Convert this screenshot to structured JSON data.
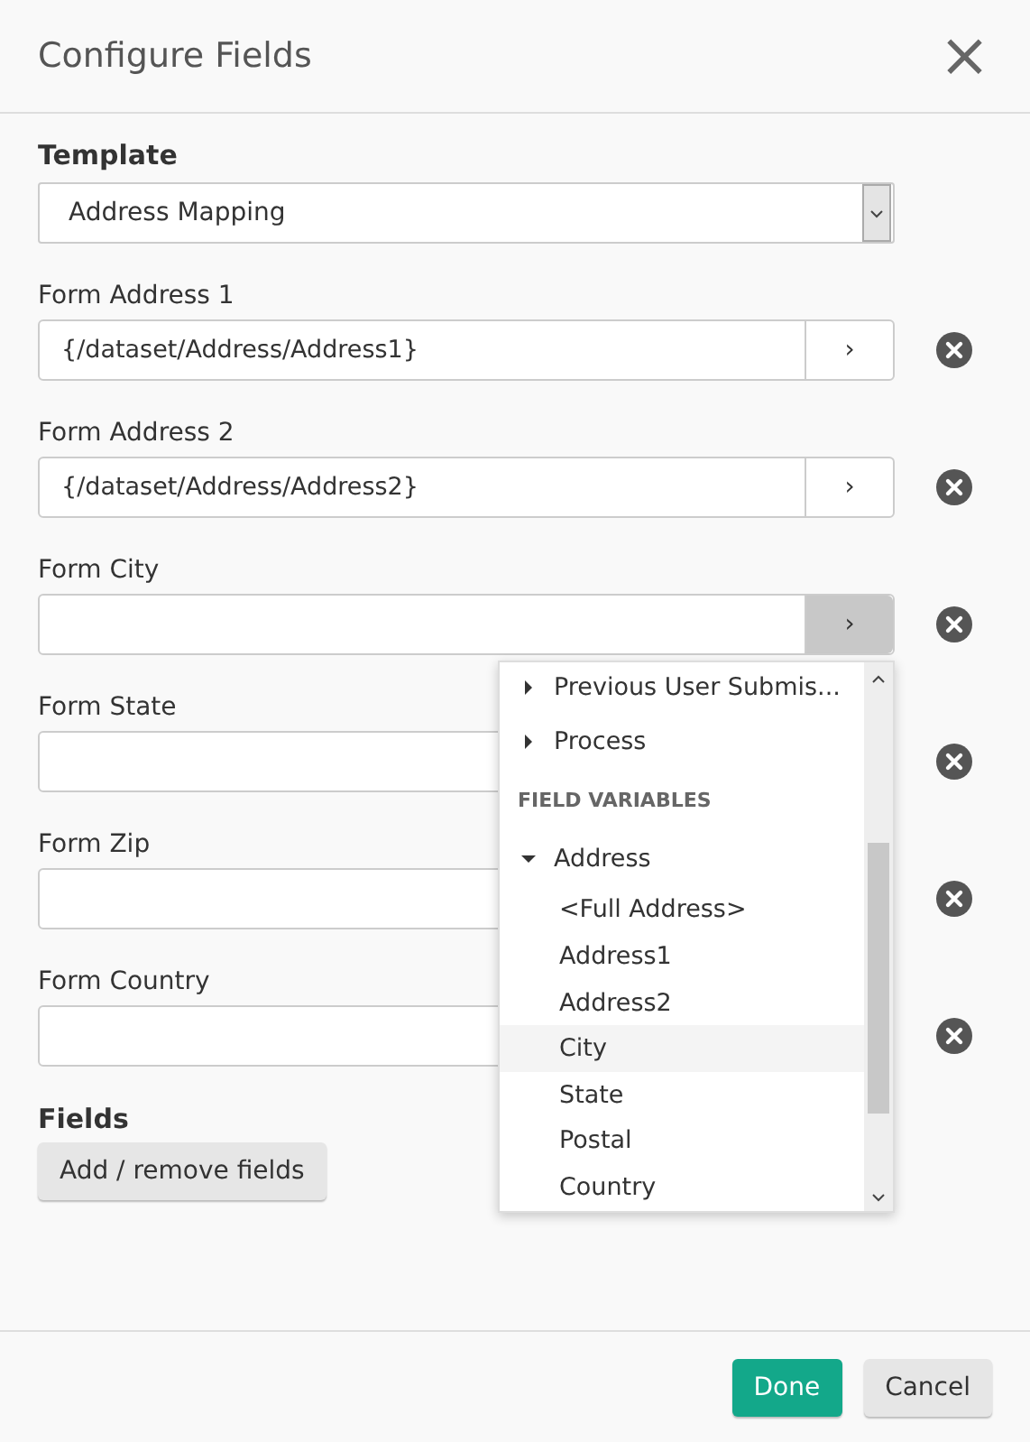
{
  "dialog": {
    "title": "Configure Fields",
    "close": "×"
  },
  "template": {
    "label": "Template",
    "value": "Address Mapping"
  },
  "fields": [
    {
      "label": "Form Address 1",
      "value": "{/dataset/Address/Address1}",
      "button": "›",
      "active": false
    },
    {
      "label": "Form Address 2",
      "value": "{/dataset/Address/Address2}",
      "button": "›",
      "active": false
    },
    {
      "label": "Form City",
      "button": "›",
      "active": true
    },
    {
      "label": "Form State"
    },
    {
      "label": "Form Zip"
    },
    {
      "label": "Form Country"
    }
  ],
  "picker": {
    "groups": [
      {
        "label": "Previous User Submis...",
        "expanded": false
      },
      {
        "label": "Process",
        "expanded": false
      }
    ],
    "section": "FIELD VARIABLES",
    "tree": [
      {
        "label": "Address",
        "expanded": true,
        "children": [
          {
            "label": "<Full Address>",
            "selected": false
          },
          {
            "label": "Address1",
            "selected": false
          },
          {
            "label": "Address2",
            "selected": false
          },
          {
            "label": "City",
            "selected": true
          },
          {
            "label": "State",
            "selected": false
          },
          {
            "label": "Postal",
            "selected": false
          },
          {
            "label": "Country",
            "selected": false
          }
        ]
      }
    ]
  },
  "fields_section": {
    "label": "Fields",
    "button": "Add / remove fields"
  },
  "footer": {
    "buttons": [
      {
        "label": "Done",
        "kind": "primary"
      },
      {
        "label": "Cancel",
        "kind": "secondary"
      }
    ]
  }
}
